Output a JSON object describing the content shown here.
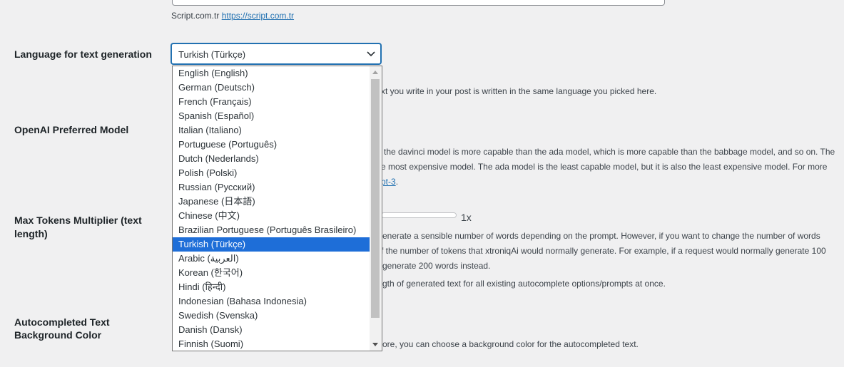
{
  "top_field": {
    "note_text": "Script.com.tr",
    "note_link": "https://script.com.tr"
  },
  "language": {
    "label": "Language for text generation",
    "selected": "Turkish (Türkçe)",
    "desc_visible": "xt you write in your post is written in the same language you picked here.",
    "options": [
      "English (English)",
      "German (Deutsch)",
      "French (Français)",
      "Spanish (Español)",
      "Italian (Italiano)",
      "Portuguese (Português)",
      "Dutch (Nederlands)",
      "Polish (Polski)",
      "Russian (Русский)",
      "Japanese (日本語)",
      "Chinese (中文)",
      "Brazilian Portuguese (Português Brasileiro)",
      "Turkish (Türkçe)",
      "Arabic (العربية)",
      "Korean (한국어)",
      "Hindi (हिन्दी)",
      "Indonesian (Bahasa Indonesia)",
      "Swedish (Svenska)",
      "Danish (Dansk)",
      "Finnish (Suomi)"
    ],
    "selected_index": 12
  },
  "model": {
    "label": "OpenAI Preferred Model",
    "desc_line1": "the davinci model is more capable than the ada model, which is more capable than the babbage model, and so on. The",
    "desc_line2": "e most expensive model. The ada model is the least capable model, but it is also the least expensive model. For more",
    "desc_link": "pt-3",
    "desc_link_after": "."
  },
  "tokens": {
    "label_line1": "Max Tokens Multiplier (text",
    "label_line2": "length)",
    "slider_value": "1x",
    "desc_line1": "enerate a sensible number of words depending on the prompt. However, if you want to change the number of words",
    "desc_line2": "f the number of tokens that xtroniqAi would normally generate. For example, if a request would normally generate 100",
    "desc_line3": "generate 200 words instead.",
    "desc_line4": "gth of generated text for all existing autocomplete options/prompts at once."
  },
  "bg_color": {
    "label_line1": "Autocompleted Text",
    "label_line2": "Background Color",
    "desc": "ore, you can choose a background color for the autocompleted text."
  },
  "colors": {
    "selected_bg": "#1e6ed8",
    "link": "#2271b1",
    "focus_border": "#2271b1"
  }
}
